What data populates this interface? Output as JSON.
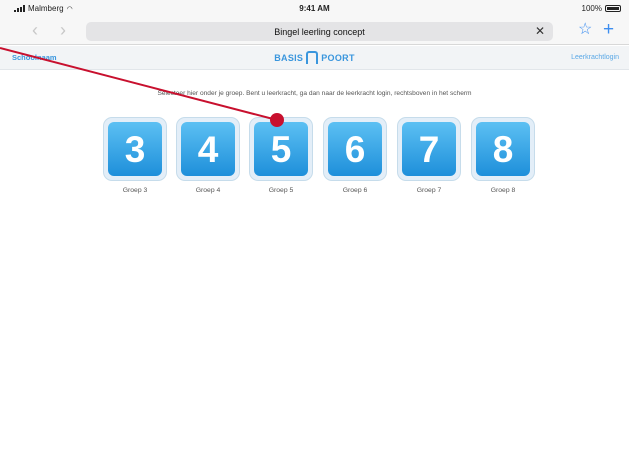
{
  "status": {
    "carrier": "Malmberg",
    "time": "9:41 AM",
    "battery": "100%"
  },
  "browser": {
    "page_title": "Bingel leerling concept",
    "icons": {
      "back": "chevron-left-icon",
      "forward": "chevron-right-icon",
      "close": "close-icon",
      "bookmark": "star-icon",
      "new_tab": "plus-icon"
    }
  },
  "header": {
    "school_link": "Schoolnaam",
    "brand_left": "BASIS",
    "brand_right": "POORT",
    "teacher_link": "Leerkrachtlogin"
  },
  "instruction": "Selecteer hier onder je groep. Bent u leerkracht, ga dan naar de leerkracht login, rechtsboven in het scherm",
  "groups": [
    {
      "number": "3",
      "label": "Groep 3"
    },
    {
      "number": "4",
      "label": "Groep 4"
    },
    {
      "number": "5",
      "label": "Groep 5"
    },
    {
      "number": "6",
      "label": "Groep 6"
    },
    {
      "number": "7",
      "label": "Groep 7"
    },
    {
      "number": "8",
      "label": "Groep 8"
    }
  ],
  "colors": {
    "accent": "#3a96dd",
    "tile_top": "#5cc0f3",
    "tile_bottom": "#1e8fda",
    "annotation": "#c8102e"
  }
}
